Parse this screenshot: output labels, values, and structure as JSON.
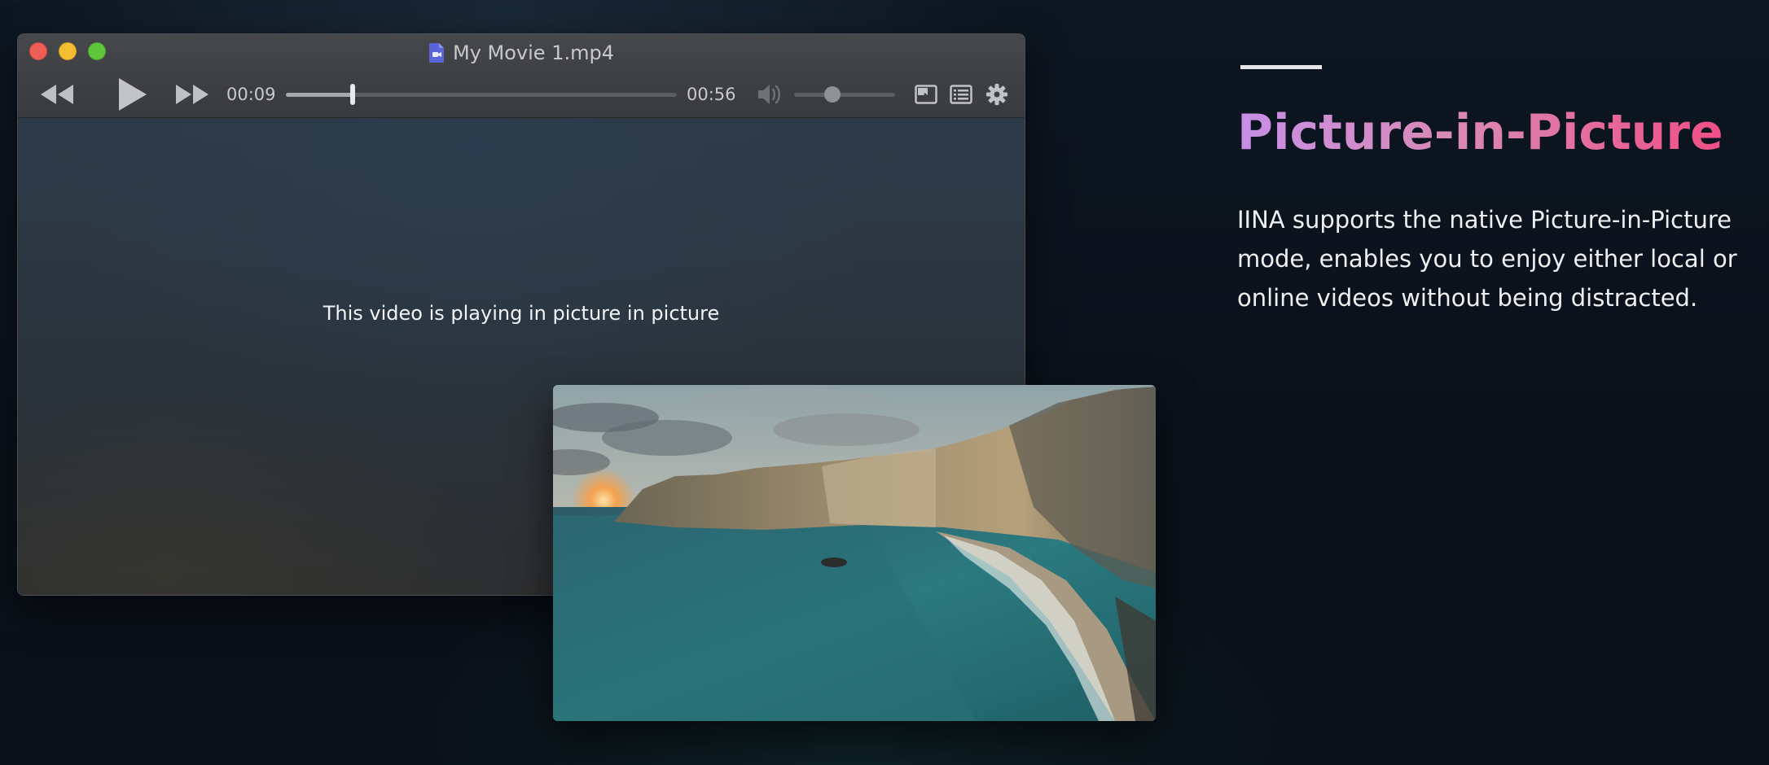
{
  "player_window": {
    "title": "My Movie 1.mp4",
    "title_icon": "video-file-icon",
    "controls": {
      "rewind_icon": "rewind-icon",
      "play_icon": "play-icon",
      "fast_forward_icon": "fast-forward-icon",
      "current_time": "00:09",
      "total_time": "00:56",
      "progress_fraction": 0.17,
      "volume_icon": "speaker-icon",
      "volume_fraction": 0.38,
      "pip_icon": "picture-in-picture-icon",
      "playlist_icon": "playlist-icon",
      "settings_icon": "gear-icon"
    },
    "video_message": "This video is playing in picture in picture"
  },
  "pip_window": {
    "content": "coastal-cliff-sunset-image"
  },
  "feature": {
    "title": "Picture-in-Picture",
    "description": "IINA supports the native Picture-in-Picture mode, enables you to enjoy either local or online videos without being distracted."
  },
  "colors": {
    "title_gradient_start": "#c68fe6",
    "title_gradient_end": "#ef4f86",
    "close": "#ee5e57",
    "minimize": "#f3bd30",
    "maximize": "#5fc53a"
  }
}
